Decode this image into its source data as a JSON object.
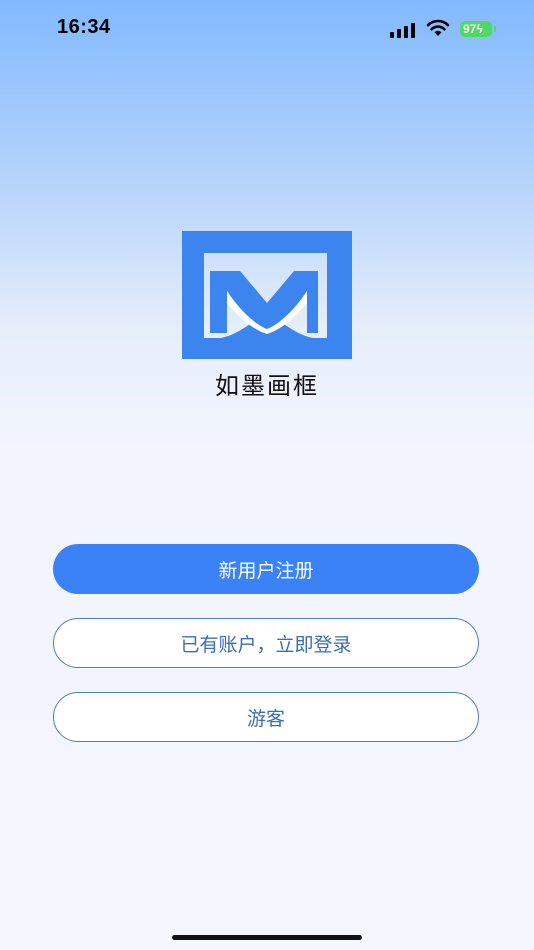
{
  "status": {
    "time": "16:34",
    "battery": "97"
  },
  "app": {
    "name": "如墨画框",
    "logo_icon": "frame-logo-icon",
    "brand_color": "#3c85ef"
  },
  "actions": {
    "register": "新用户注册",
    "login": "已有账户，立即登录",
    "guest": "游客"
  },
  "colors": {
    "primary": "#3b82f6",
    "outline_border": "#4f7fb8",
    "outline_text": "#3b6fb0"
  }
}
